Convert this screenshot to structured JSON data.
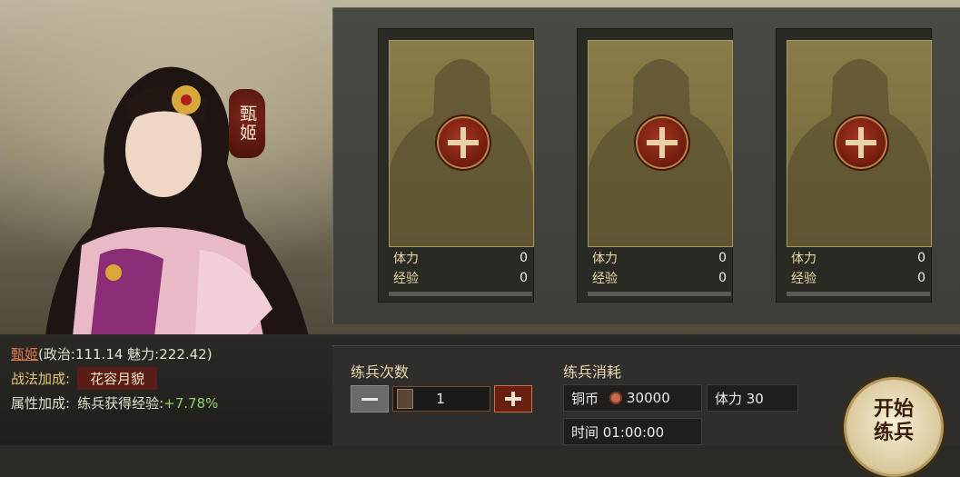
{
  "hero": {
    "name": "甄姬",
    "name_tag": "甄姬",
    "stats_text": "(政治:111.14 魅力:222.42)",
    "tactic_label": "战法加成:",
    "tactic_name": "花容月貌",
    "attr_label": "属性加成:",
    "attr_text": "练兵获得经验:",
    "attr_pct": "+7.78%"
  },
  "slots": [
    {
      "stamina_label": "体力",
      "stamina": "0",
      "exp_label": "经验",
      "exp": "0"
    },
    {
      "stamina_label": "体力",
      "stamina": "0",
      "exp_label": "经验",
      "exp": "0"
    },
    {
      "stamina_label": "体力",
      "stamina": "0",
      "exp_label": "经验",
      "exp": "0"
    }
  ],
  "training": {
    "count_title": "练兵次数",
    "count_value": "1",
    "cost_title": "练兵消耗",
    "copper_label": "铜币",
    "copper_value": "30000",
    "stamina_cost": "体力 30",
    "time_text": "时间 01:00:00",
    "start_label": "开始练兵"
  },
  "colors": {
    "accent_red": "#6e1a0d",
    "gold_text": "#e9c77a",
    "bonus_green": "#8fd06a"
  }
}
